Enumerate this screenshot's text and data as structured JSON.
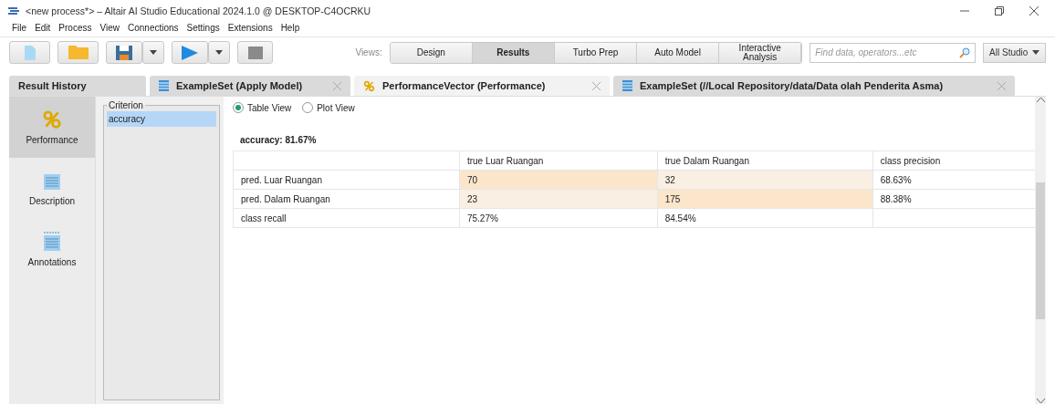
{
  "window": {
    "title": "<new process*> – Altair AI Studio Educational 2024.1.0 @ DESKTOP-C4OCRKU"
  },
  "menu": [
    "File",
    "Edit",
    "Process",
    "View",
    "Connections",
    "Settings",
    "Extensions",
    "Help"
  ],
  "views": {
    "label": "Views:",
    "items": [
      {
        "label": "Design",
        "selected": false
      },
      {
        "label": "Results",
        "selected": true
      },
      {
        "label": "Turbo Prep",
        "selected": false
      },
      {
        "label": "Auto Model",
        "selected": false
      },
      {
        "label": "Interactive Analysis",
        "selected": false
      }
    ]
  },
  "search": {
    "placeholder": "Find data, operators...etc"
  },
  "perspective": "All Studio",
  "tabs": [
    {
      "label": "Result History",
      "kind": "history",
      "selected": false
    },
    {
      "label": "ExampleSet (Apply Model)",
      "kind": "data",
      "selected": false
    },
    {
      "label": "PerformanceVector (Performance)",
      "kind": "performance",
      "selected": true
    },
    {
      "label": "ExampleSet (//Local Repository/data/Data olah Penderita Asma)",
      "kind": "data",
      "selected": false
    }
  ],
  "sidebar": {
    "items": [
      {
        "label": "Performance",
        "kind": "performance",
        "selected": true
      },
      {
        "label": "Description",
        "kind": "description",
        "selected": false
      },
      {
        "label": "Annotations",
        "kind": "annotations",
        "selected": false
      }
    ]
  },
  "criterion": {
    "title": "Criterion",
    "items": [
      {
        "label": "accuracy",
        "selected": true
      }
    ]
  },
  "view_mode": [
    {
      "label": "Table View",
      "selected": true
    },
    {
      "label": "Plot View",
      "selected": false
    }
  ],
  "accuracy": "accuracy: 81.67%",
  "table": {
    "columns": [
      "true Luar Ruangan",
      "true Dalam Ruangan",
      "class precision"
    ],
    "rows": [
      {
        "label": "pred. Luar Ruangan",
        "cells": [
          {
            "text": "70",
            "kind": "strong"
          },
          {
            "text": "32",
            "kind": "light"
          },
          {
            "text": "68.63%",
            "kind": "plain"
          }
        ]
      },
      {
        "label": "pred. Dalam Ruangan",
        "cells": [
          {
            "text": "23",
            "kind": "light"
          },
          {
            "text": "175",
            "kind": "strong"
          },
          {
            "text": "88.38%",
            "kind": "plain"
          }
        ]
      },
      {
        "label": "class recall",
        "cells": [
          {
            "text": "75.27%",
            "kind": "plain"
          },
          {
            "text": "84.54%",
            "kind": "plain"
          },
          {
            "text": "",
            "kind": "plain"
          }
        ]
      }
    ]
  }
}
